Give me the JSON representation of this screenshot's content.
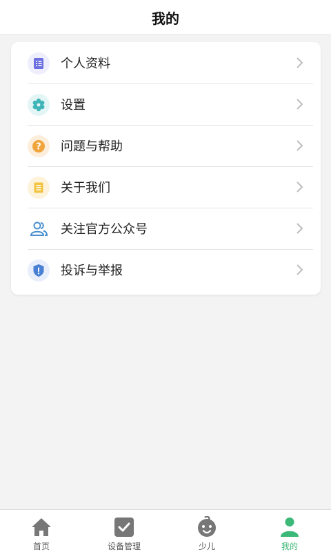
{
  "header": {
    "title": "我的"
  },
  "menu": {
    "items": [
      {
        "label": "个人资料",
        "icon": "profile-list-icon",
        "color": "#6c6fe0",
        "bg": "#eeeefc"
      },
      {
        "label": "设置",
        "icon": "gear-icon",
        "color": "#40b5b8",
        "bg": "#e4f5f6"
      },
      {
        "label": "问题与帮助",
        "icon": "question-icon",
        "color": "#f0a43c",
        "bg": "#fdeedb"
      },
      {
        "label": "关于我们",
        "icon": "document-icon",
        "color": "#f2c340",
        "bg": "#fdf3da"
      },
      {
        "label": "关注官方公众号",
        "icon": "users-icon",
        "color": "#4a8fcf",
        "bg": "transparent"
      },
      {
        "label": "投诉与举报",
        "icon": "shield-alert-icon",
        "color": "#4a7fd6",
        "bg": "#e8eefb"
      }
    ]
  },
  "tabbar": {
    "items": [
      {
        "label": "首页",
        "icon": "home-icon"
      },
      {
        "label": "设备管理",
        "icon": "checkbox-icon"
      },
      {
        "label": "少儿",
        "icon": "baby-icon"
      },
      {
        "label": "我的",
        "icon": "person-icon",
        "active": true
      }
    ],
    "active_color": "#3cb878",
    "inactive_color": "#777777"
  }
}
